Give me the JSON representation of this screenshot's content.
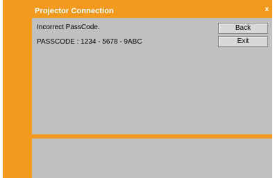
{
  "window": {
    "title": "Projector Connection",
    "close_label": "x"
  },
  "message": {
    "error": "Incorrect PassCode.",
    "passcode": "PASSCODE : 1234 - 5678 - 9ABC"
  },
  "buttons": {
    "back": "Back",
    "exit": "Exit"
  },
  "colors": {
    "accent": "#f39a1e",
    "panel": "#c0c0c0",
    "button": "#d8d8d8"
  }
}
